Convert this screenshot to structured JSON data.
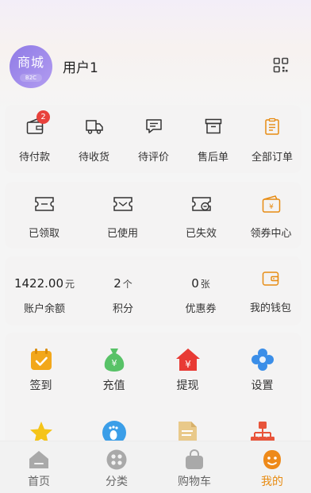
{
  "header": {
    "avatar_text": "商城",
    "avatar_sub": "B2C",
    "username": "用户1"
  },
  "orders": {
    "items": [
      {
        "label": "待付款",
        "badge": "2",
        "icon": "wallet-icon"
      },
      {
        "label": "待收货",
        "icon": "truck-icon"
      },
      {
        "label": "待评价",
        "icon": "comment-icon"
      },
      {
        "label": "售后单",
        "icon": "return-box-icon"
      },
      {
        "label": "全部订单",
        "icon": "order-list-icon"
      }
    ]
  },
  "coupons": {
    "items": [
      {
        "label": "已领取",
        "icon": "ticket-icon"
      },
      {
        "label": "已使用",
        "icon": "ticket-check-icon"
      },
      {
        "label": "已失效",
        "icon": "ticket-expired-icon"
      },
      {
        "label": "领券中心",
        "icon": "coupon-center-icon"
      }
    ]
  },
  "assets": {
    "balance": {
      "value": "1422.00",
      "unit": "元",
      "label": "账户余额"
    },
    "points": {
      "value": "2",
      "unit": "个",
      "label": "积分"
    },
    "vouchers": {
      "value": "0",
      "unit": "张",
      "label": "优惠券"
    },
    "wallet": {
      "label": "我的钱包",
      "icon": "purse-icon"
    }
  },
  "services": {
    "items": [
      {
        "label": "签到",
        "icon": "calendar-check-icon",
        "color": "#f2a71b"
      },
      {
        "label": "充值",
        "icon": "money-bag-icon",
        "color": "#58c267"
      },
      {
        "label": "提现",
        "icon": "house-yen-icon",
        "color": "#e83a34"
      },
      {
        "label": "设置",
        "icon": "flower-gear-icon",
        "color": "#3b8ee8"
      }
    ]
  },
  "tabbar": {
    "items": [
      {
        "label": "首页",
        "icon": "home-icon"
      },
      {
        "label": "分类",
        "icon": "category-icon"
      },
      {
        "label": "购物车",
        "icon": "cart-icon"
      },
      {
        "label": "我的",
        "icon": "profile-icon",
        "active": true
      }
    ]
  },
  "colors": {
    "accent": "#e78b12",
    "badge": "#e8413c",
    "avatar": "#8f7be6"
  }
}
